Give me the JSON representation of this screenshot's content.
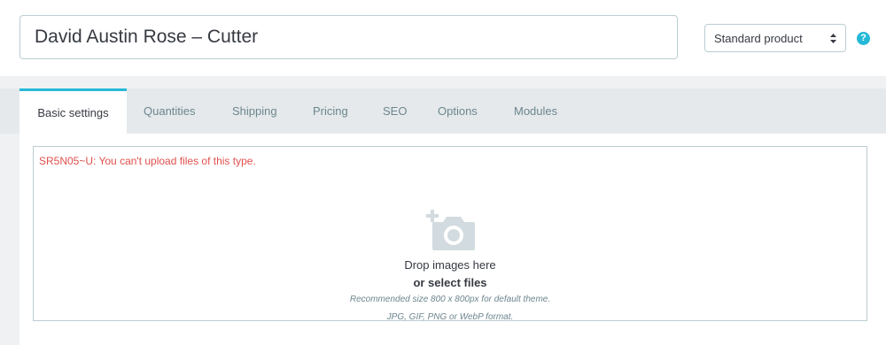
{
  "header": {
    "product_name": "David Austin Rose – Cutter",
    "product_type": "Standard product",
    "help_symbol": "?"
  },
  "tabs": [
    {
      "label": "Basic settings",
      "active": true
    },
    {
      "label": "Quantities"
    },
    {
      "label": "Shipping"
    },
    {
      "label": "Pricing"
    },
    {
      "label": "SEO"
    },
    {
      "label": "Options"
    },
    {
      "label": "Modules"
    }
  ],
  "dropzone": {
    "error": "SR5N05~U: You can't upload files of this type.",
    "drop_label": "Drop images here",
    "select_label": "or select files",
    "hint_size": "Recommended size 800 x 800px for default theme.",
    "hint_format": "JPG, GIF, PNG or WebP format.",
    "icon": "add-photo-icon"
  },
  "colors": {
    "accent": "#25b9d7",
    "error": "#e0504d",
    "border": "#bbcdd2",
    "muted": "#6c868e"
  }
}
